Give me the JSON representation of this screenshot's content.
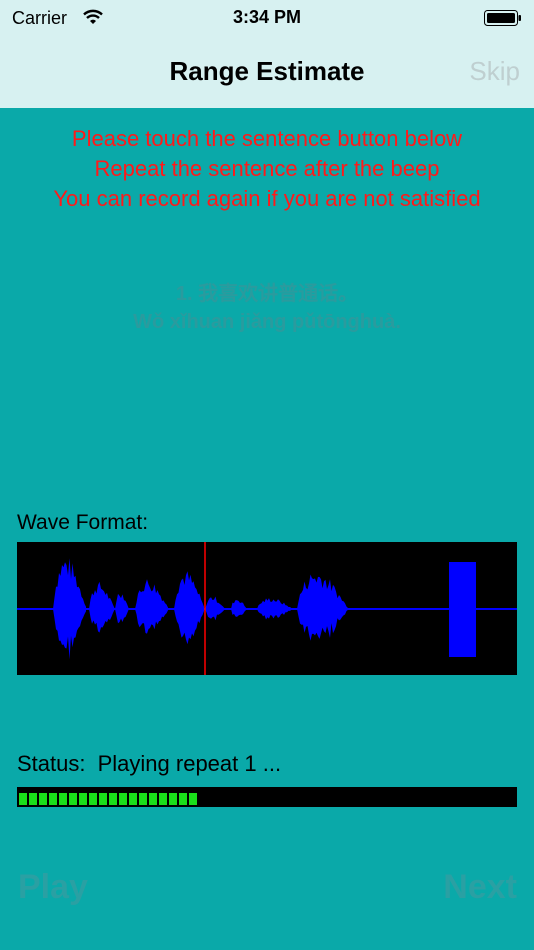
{
  "status_bar": {
    "carrier": "Carrier",
    "time": "3:34 PM"
  },
  "nav": {
    "title": "Range Estimate",
    "skip_label": "Skip"
  },
  "instructions": [
    "Please touch the sentence button below",
    "Repeat the sentence after the beep",
    "You can record again if you are not satisfied"
  ],
  "sentence": {
    "chinese": "1. 我喜欢讲普通话。",
    "pinyin": "Wǒ xǐhuan jiǎng pǔtōnghuà."
  },
  "wave": {
    "label": "Wave Format:"
  },
  "status": {
    "label": "Status:",
    "text": "Playing repeat 1 ..."
  },
  "progress": {
    "filled_fraction": 0.355
  },
  "buttons": {
    "play": "Play",
    "next": "Next"
  },
  "colors": {
    "background": "#0aa9a9",
    "bar": "#d7f1f1",
    "instruction": "#ff1a1a",
    "waveform": "#0000ff",
    "cursor": "#ff0000",
    "progress": "#1adf1a"
  }
}
